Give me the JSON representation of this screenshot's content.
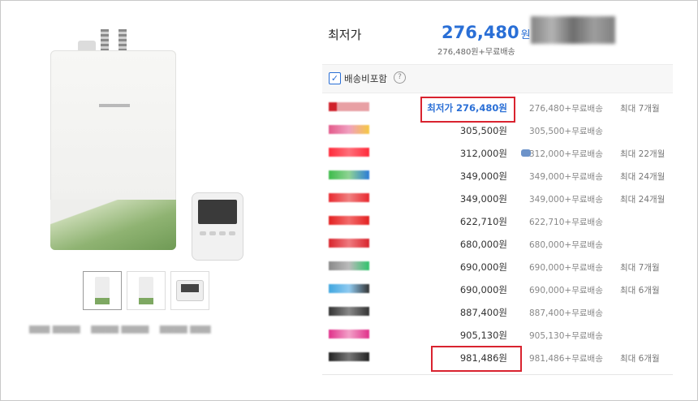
{
  "summary": {
    "lowest_label": "최저가",
    "lowest_price": "276,480",
    "won": "원",
    "lowest_sub": "276,480원+무료배송"
  },
  "shipping_toggle": {
    "label": "배송비포함",
    "checked": true
  },
  "rows": [
    {
      "mall": "mall-logo-red",
      "price": "276,480원",
      "best_prefix": "최저가 ",
      "best": true,
      "ship": "276,480+무료배송",
      "inst": "최대 7개월",
      "card": false
    },
    {
      "mall": "mall-logo-pink",
      "price": "305,500원",
      "best": false,
      "ship": "305,500+무료배송",
      "inst": "",
      "card": false
    },
    {
      "mall": "mall-logo-11",
      "price": "312,000원",
      "best": false,
      "ship": "312,000+무료배송",
      "inst": "최대 22개월",
      "card": true
    },
    {
      "mall": "mall-logo-green",
      "price": "349,000원",
      "best": false,
      "ship": "349,000+무료배송",
      "inst": "최대 24개월",
      "card": false
    },
    {
      "mall": "mall-logo-auction",
      "price": "349,000원",
      "best": false,
      "ship": "349,000+무료배송",
      "inst": "최대 24개월",
      "card": false
    },
    {
      "mall": "mall-logo-red2",
      "price": "622,710원",
      "best": false,
      "ship": "622,710+무료배송",
      "inst": "",
      "card": false
    },
    {
      "mall": "mall-logo-red3",
      "price": "680,000원",
      "best": false,
      "ship": "680,000+무료배송",
      "inst": "",
      "card": false
    },
    {
      "mall": "mall-logo-gray",
      "price": "690,000원",
      "best": false,
      "ship": "690,000+무료배송",
      "inst": "최대 7개월",
      "card": false
    },
    {
      "mall": "mall-logo-blue",
      "price": "690,000원",
      "best": false,
      "ship": "690,000+무료배송",
      "inst": "최대 6개월",
      "card": false
    },
    {
      "mall": "mall-logo-dark",
      "price": "887,400원",
      "best": false,
      "ship": "887,400+무료배송",
      "inst": "",
      "card": false
    },
    {
      "mall": "mall-logo-pink2",
      "price": "905,130원",
      "best": false,
      "ship": "905,130+무료배송",
      "inst": "",
      "card": false
    },
    {
      "mall": "mall-logo-black",
      "price": "981,486원",
      "best": false,
      "ship": "981,486+무료배송",
      "inst": "최대 6개월",
      "card": false
    }
  ],
  "colors": {
    "accent": "#2a6fd6",
    "highlight": "#d9232f"
  }
}
